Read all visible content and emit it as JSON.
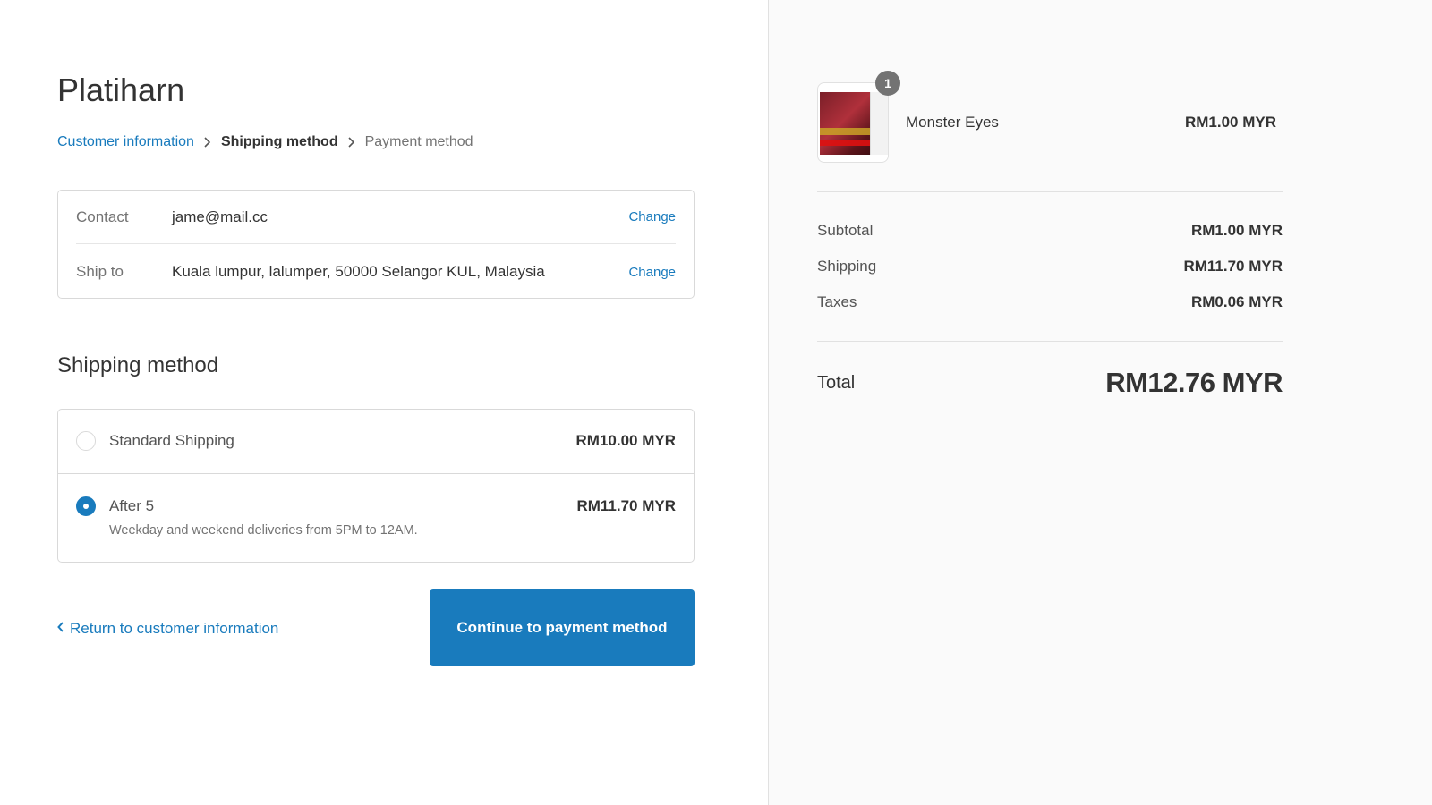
{
  "shop": {
    "name": "Platiharn"
  },
  "breadcrumb": {
    "step1": "Customer information",
    "step2": "Shipping method",
    "step3": "Payment method"
  },
  "review": {
    "contact_label": "Contact",
    "contact_value": "jame@mail.cc",
    "ship_label": "Ship to",
    "ship_value": "Kuala lumpur, lalumper, 50000 Selangor KUL, Malaysia",
    "change_label": "Change"
  },
  "shipping": {
    "title": "Shipping method",
    "options": [
      {
        "label": "Standard Shipping",
        "price": "RM10.00 MYR",
        "description": "",
        "selected": false
      },
      {
        "label": "After 5",
        "price": "RM11.70 MYR",
        "description": "Weekday and weekend deliveries from 5PM to 12AM.",
        "selected": true
      }
    ]
  },
  "nav": {
    "return_label": "Return to customer information",
    "continue_label": "Continue to payment method"
  },
  "order": {
    "product": {
      "name": "Monster Eyes",
      "price": "RM1.00 MYR",
      "quantity": "1"
    },
    "subtotal_label": "Subtotal",
    "subtotal_value": "RM1.00 MYR",
    "shipping_label": "Shipping",
    "shipping_value": "RM11.70 MYR",
    "taxes_label": "Taxes",
    "taxes_value": "RM0.06 MYR",
    "total_label": "Total",
    "total_value": "RM12.76 MYR"
  },
  "colors": {
    "accent": "#197bbd",
    "sidebar_bg": "#fafafa",
    "badge": "#737373"
  },
  "icons": {
    "breadcrumb_separator": "chevron-right-icon",
    "return": "chevron-left-icon"
  }
}
